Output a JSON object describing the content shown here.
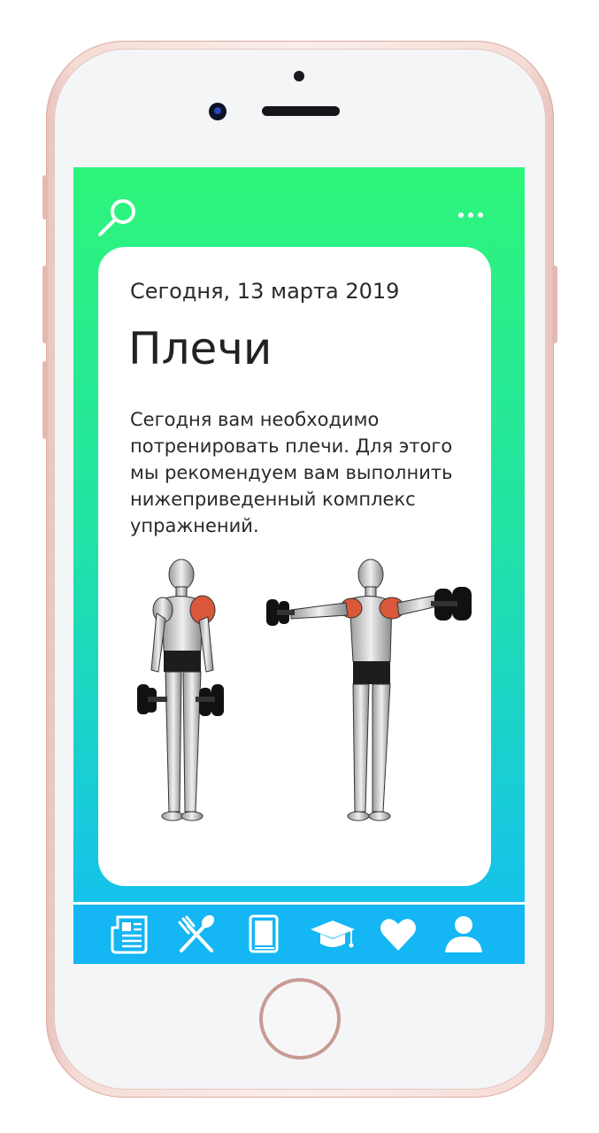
{
  "header": {
    "search_icon": "search-icon",
    "more_icon": "more-dots-icon"
  },
  "card": {
    "date": "Сегодня, 13 марта 2019",
    "title": "Плечи",
    "description": "Сегодня вам необходимо потренировать плечи. Для этого мы рекомендуем вам выполнить нижеприведенный комплекс упражнений.",
    "illustration_icon": "shoulder-exercise-illustration"
  },
  "tabbar": {
    "items": [
      {
        "icon": "newspaper-icon"
      },
      {
        "icon": "fork-spoon-icon"
      },
      {
        "icon": "book-icon"
      },
      {
        "icon": "graduation-cap-icon"
      },
      {
        "icon": "heart-icon"
      },
      {
        "icon": "user-icon"
      }
    ]
  },
  "colors": {
    "gradient_top": "#2ef57a",
    "gradient_bottom": "#13baf6",
    "tabbar": "#14b6f3",
    "muscle_highlight": "#d9573a"
  }
}
